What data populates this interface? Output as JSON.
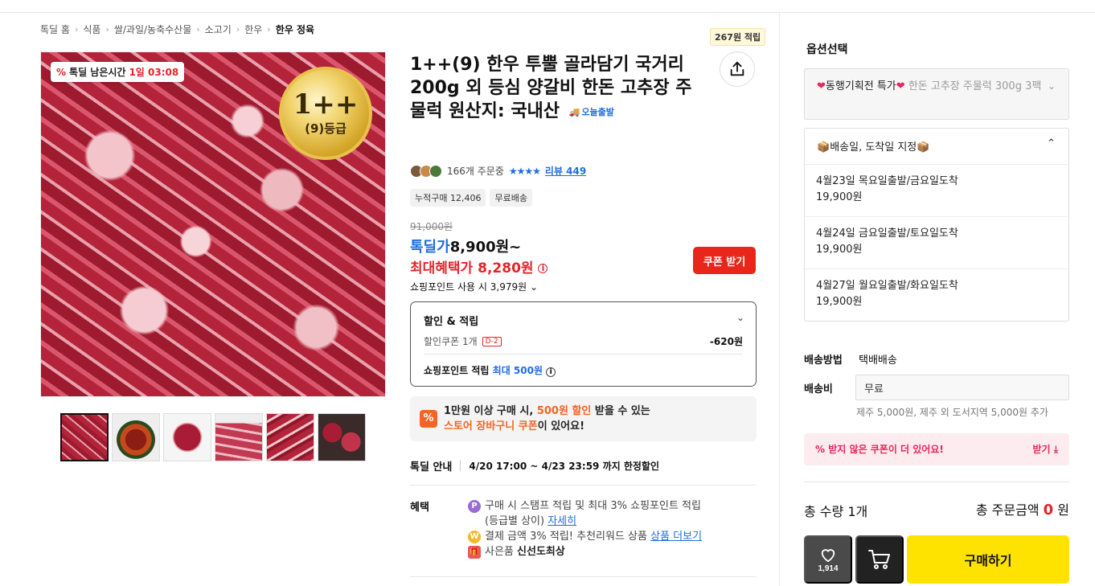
{
  "breadcrumb": [
    "톡딜 홈",
    "식품",
    "쌀/과일/농축수산물",
    "소고기",
    "한우",
    "한우 정육"
  ],
  "image": {
    "timer_label": "톡딜 남은시간",
    "timer_value": "1일 03:08",
    "seal_big": "1++",
    "seal_small": "(9)등급"
  },
  "product": {
    "title": "1++(9) 한우 투뿔 골라담기 국거리 200g 외 등심 양갈비 한돈 고추장 주물럭 원산지: 국내산",
    "today_ship": "오늘출발",
    "points_tag": "267원 적립",
    "order_count": "166개 주문중",
    "stars": "★★★★",
    "review_link": "리뷰 449",
    "badges": [
      "누적구매 12,406",
      "무료배송"
    ],
    "original_price": "91,000원",
    "deal_label": "톡딜가",
    "deal_price": "8,900원~",
    "max_benefit_label": "최대혜택가",
    "max_benefit_price": "8,280원",
    "coupon_button": "쿠폰 받기",
    "shop_point_use": "쇼핑포인트 사용 시 3,979원"
  },
  "discount": {
    "header": "할인 & 적립",
    "coupon_label": "할인쿠폰 1개",
    "coupon_dday": "D-2",
    "coupon_amount": "-620원",
    "point_label": "쇼핑포인트 적립",
    "point_value": "최대 500원"
  },
  "promo": {
    "line1_a": "1만원 이상 구매 시, ",
    "line1_b": "500원 할인",
    "line1_c": " 받을 수 있는",
    "line2_a": "스토어 장바구니 쿠폰",
    "line2_b": "이 있어요!"
  },
  "deal_info": {
    "label": "톡딜 안내",
    "value": "4/20 17:00 ~ 4/23 23:59 까지 한정할인"
  },
  "benefits": {
    "label": "혜택",
    "item1": "구매 시 스탬프 적립 및 최대 3% 쇼핑포인트 적립",
    "item1b": "(등급별 상이)",
    "item1_link": "자세히",
    "item2": "결제 금액 3% 적립! 추천리워드 상품",
    "item2_link": "상품 더보기",
    "item3": "사은품",
    "item3_value": "신선도최상"
  },
  "options": {
    "title": "옵션선택",
    "selected_prefix": "동행기획전 특가",
    "selected_value": "한돈 고추장 주물럭 300g 3팩",
    "ship_header": "배송일, 도착일 지정",
    "ship_options": [
      {
        "date": "4월23일 목요일출발/금요일도착",
        "price": "19,900원"
      },
      {
        "date": "4월24일 금요일출발/토요일도착",
        "price": "19,900원"
      },
      {
        "date": "4월27일 월요일출발/화요일도착",
        "price": "19,900원"
      }
    ]
  },
  "shipping": {
    "method_label": "배송방법",
    "method_value": "택배배송",
    "fee_label": "배송비",
    "fee_value": "무료",
    "fee_note": "제주 5,000원, 제주 외 도서지역 5,000원 추가"
  },
  "coupon_alert": {
    "text": "받지 않은 쿠폰이 더 있어요!",
    "action": "받기"
  },
  "totals": {
    "qty_label": "총 수량 1개",
    "amount_label": "총 주문금액",
    "amount_value": "0",
    "amount_unit": "원"
  },
  "actions": {
    "wish_count": "1,914",
    "buy_label": "구매하기"
  },
  "colors": {
    "accent_blue": "#1e6de0",
    "accent_red": "#e3242b",
    "buy_yellow": "#ffe300"
  }
}
